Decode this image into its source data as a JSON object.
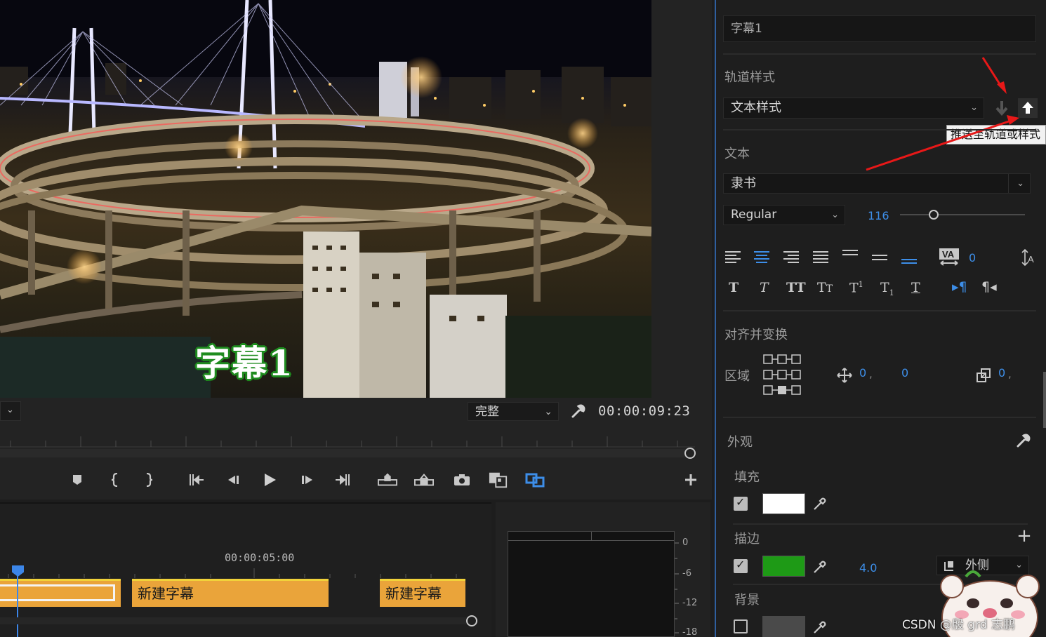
{
  "program_monitor": {
    "caption_text": "字幕1",
    "quality": "完整",
    "timecode": "00:00:09:23"
  },
  "playback_controls": [
    {
      "name": "add-marker-button",
      "icon": "marker-icon"
    },
    {
      "name": "mark-in-button",
      "icon": "mark-in-icon"
    },
    {
      "name": "mark-out-button",
      "icon": "mark-out-icon"
    },
    {
      "name": "go-to-in-button",
      "icon": "go-to-in-icon"
    },
    {
      "name": "step-back-button",
      "icon": "step-back-icon"
    },
    {
      "name": "play-button",
      "icon": "play-icon"
    },
    {
      "name": "step-forward-button",
      "icon": "step-forward-icon"
    },
    {
      "name": "go-to-out-button",
      "icon": "go-to-out-icon"
    },
    {
      "name": "lift-button",
      "icon": "lift-icon"
    },
    {
      "name": "extract-button",
      "icon": "extract-icon"
    },
    {
      "name": "export-frame-button",
      "icon": "camera-icon"
    },
    {
      "name": "comparison-view-button",
      "icon": "comparison-icon"
    },
    {
      "name": "loop-button",
      "icon": "loop-icon"
    },
    {
      "name": "add-button",
      "icon": "plus-icon"
    }
  ],
  "timeline": {
    "timecode": "00:00:05:00",
    "clips": [
      "",
      "新建字幕",
      "新建字幕"
    ]
  },
  "audio_meter": {
    "scale": [
      "0",
      "-6",
      "-12",
      "-18"
    ]
  },
  "essential_graphics": {
    "layer_name": "字幕1",
    "track_style_label": "轨道样式",
    "track_style_value": "文本样式",
    "tooltip": "推送至轨道或样式",
    "text_label": "文本",
    "font": "隶书",
    "font_style": "Regular",
    "font_size": "116",
    "font_size_fraction": 0.27,
    "kerning": "0",
    "align_label": "对齐并变换",
    "region_label": "区域",
    "position_x": "0",
    "position_y": "0",
    "scale_value": "0",
    "appearance_label": "外观",
    "fill_label": "填充",
    "fill_enabled": true,
    "fill_color": "#ffffff",
    "stroke_label": "描边",
    "stroke_enabled": true,
    "stroke_color": "#1e9a16",
    "stroke_width": "4.0",
    "stroke_position": "外侧",
    "background_label": "背景",
    "background_enabled": false,
    "accent_color": "#3d8ee8"
  },
  "watermark": "CSDN @殷 grd 志鹏"
}
